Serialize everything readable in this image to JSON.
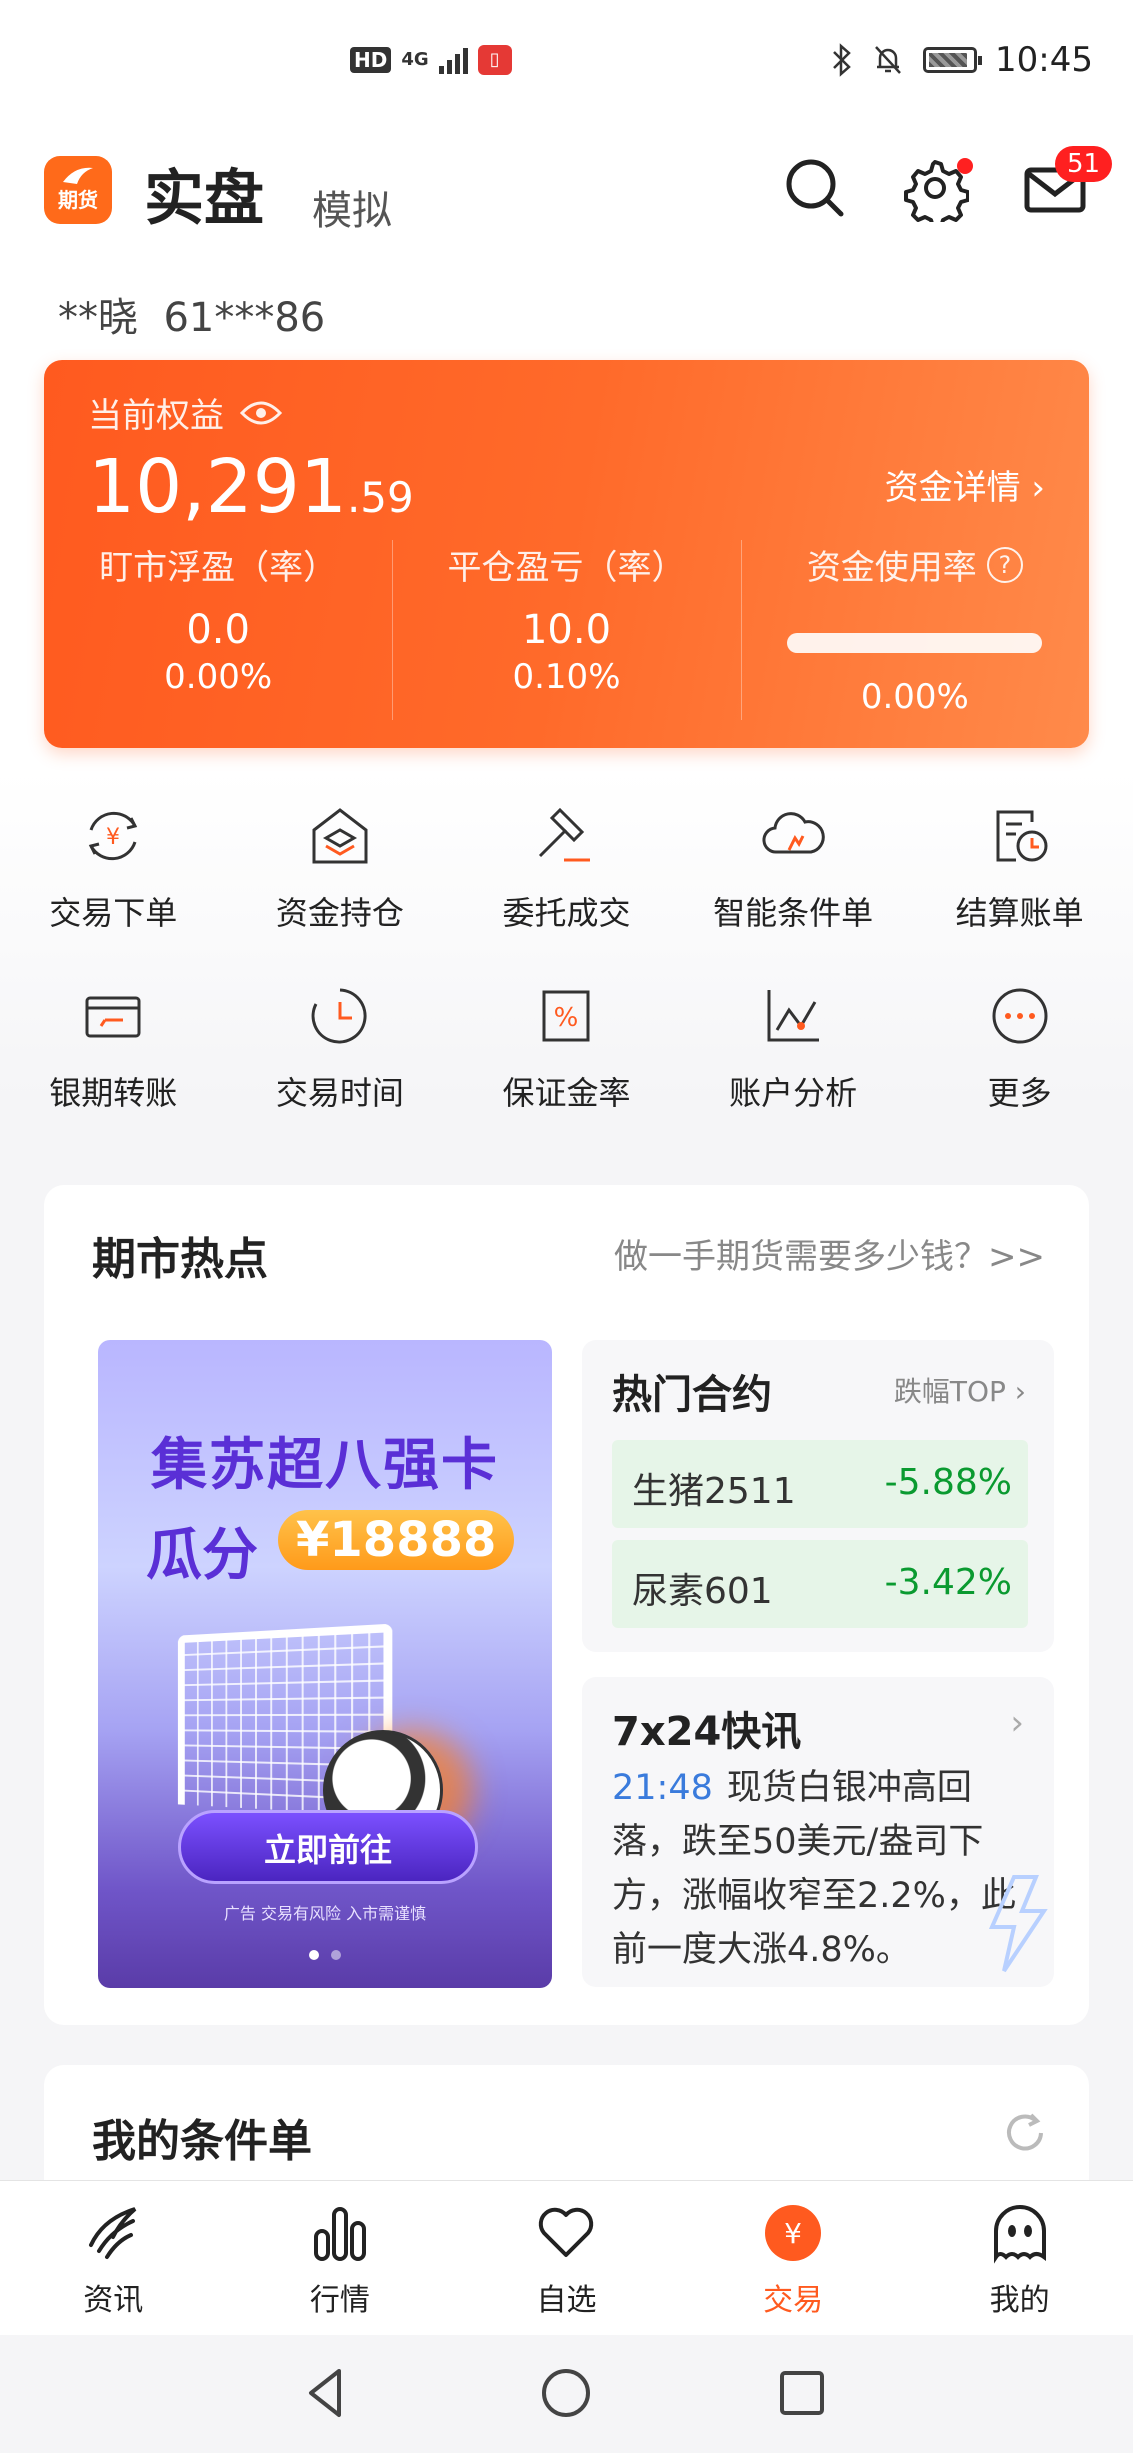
{
  "status": {
    "hd": "HD",
    "network": "4G",
    "time": "10:45"
  },
  "header": {
    "logo_text": "期货",
    "tab_real": "实盘",
    "tab_sim": "模拟",
    "mail_badge": "51"
  },
  "account": {
    "name": "**晓",
    "id": "61***86"
  },
  "equity": {
    "label": "当前权益",
    "value_int": "10,291",
    "value_dec": ".59",
    "detail_link": "资金详情 ›",
    "floating_label": "盯市浮盈（率）",
    "floating_value": "0.0",
    "floating_rate": "0.00%",
    "close_label": "平仓盈亏（率）",
    "close_value": "10.0",
    "close_rate": "0.10%",
    "usage_label": "资金使用率",
    "usage_help": "?",
    "usage_rate": "0.00%",
    "usage_fraction": 0.0
  },
  "shortcuts": [
    {
      "label": "交易下单",
      "icon": "trade-order-icon"
    },
    {
      "label": "资金持仓",
      "icon": "funds-position-icon"
    },
    {
      "label": "委托成交",
      "icon": "order-fill-icon"
    },
    {
      "label": "智能条件单",
      "icon": "smart-condition-icon"
    },
    {
      "label": "结算账单",
      "icon": "settlement-bill-icon"
    },
    {
      "label": "银期转账",
      "icon": "bank-transfer-icon"
    },
    {
      "label": "交易时间",
      "icon": "trade-time-icon"
    },
    {
      "label": "保证金率",
      "icon": "margin-rate-icon"
    },
    {
      "label": "账户分析",
      "icon": "account-analysis-icon"
    },
    {
      "label": "更多",
      "icon": "more-icon"
    }
  ],
  "hot": {
    "title": "期市热点",
    "link": "做一手期货需要多少钱？>>",
    "banner": {
      "line1": "集苏超八强卡",
      "line2": "瓜分",
      "amount": "¥18888",
      "button": "立即前往",
      "risk": "广告 交易有风险 入市需谨慎"
    },
    "contracts": {
      "title": "热门合约",
      "sub": "跌幅TOP ›",
      "items": [
        {
          "name": "生猪2511",
          "change": "-5.88%"
        },
        {
          "name": "尿素601",
          "change": "-3.42%"
        }
      ]
    },
    "flash": {
      "title": "7x24快讯",
      "arrow": "›",
      "time": "21:48",
      "text": "现货白银冲高回落，跌至50美元/盎司下方，涨幅收窄至2.2%，此前一度大涨4.8%。"
    }
  },
  "conditions": {
    "title": "我的条件单"
  },
  "bottom_nav": [
    {
      "label": "资讯",
      "icon": "news-icon"
    },
    {
      "label": "行情",
      "icon": "market-icon"
    },
    {
      "label": "自选",
      "icon": "favorites-icon"
    },
    {
      "label": "交易",
      "icon": "trade-icon",
      "active": true
    },
    {
      "label": "我的",
      "icon": "profile-icon"
    }
  ],
  "colors": {
    "accent": "#ff5a1f",
    "down": "#0a9a30",
    "time_blue": "#3a7bdc"
  }
}
